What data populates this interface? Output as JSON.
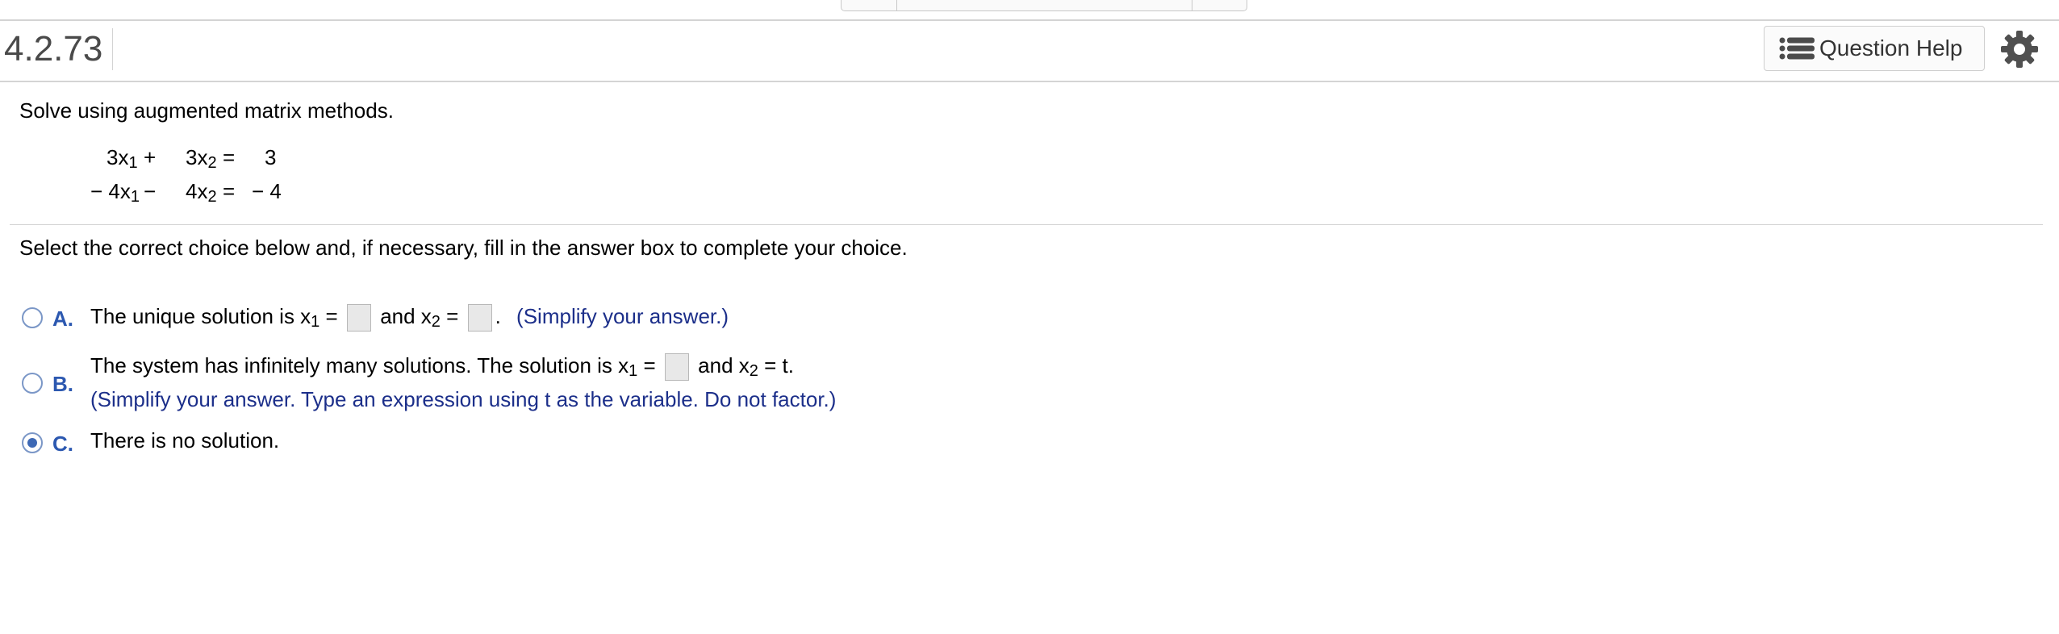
{
  "header": {
    "question_number": "4.2.73",
    "help_label": "Question Help",
    "help_icon": "list-icon",
    "settings_icon": "gear-icon"
  },
  "problem": {
    "instruction": "Solve using augmented matrix methods.",
    "equations": [
      {
        "t1_coef": "3x",
        "t1_sub": "1",
        "op": "+",
        "t2_coef": "3x",
        "t2_sub": "2",
        "eq": "=",
        "rhs": "3"
      },
      {
        "t1_coef": "− 4x",
        "t1_sub": "1",
        "op": "−",
        "t2_coef": "4x",
        "t2_sub": "2",
        "eq": "=",
        "rhs": "− 4"
      }
    ]
  },
  "prompt": "Select the correct choice below and, if necessary, fill in the answer box to complete your choice.",
  "choices": {
    "selected": "C",
    "a": {
      "letter": "A.",
      "t1": "The unique solution is x",
      "sub1": "1",
      "eq1": " =",
      "and": "and x",
      "sub2": "2",
      "eq2": " =",
      "period": ".",
      "hint": "(Simplify your answer.)",
      "value1": "",
      "value2": ""
    },
    "b": {
      "letter": "B.",
      "t1": "The system has infinitely many solutions. The solution is x",
      "sub1": "1",
      "eq1": " =",
      "and": "and x",
      "sub2": "2",
      "tail": " = t.",
      "hint": "(Simplify your answer. Type an expression using t as the variable. Do not factor.)",
      "value1": ""
    },
    "c": {
      "letter": "C.",
      "text": "There is no solution."
    }
  },
  "colors": {
    "choice_letter": "#2c58b0",
    "hint_text": "#1c2f8a",
    "radio_selected": "#3e69b5",
    "answer_box": "#e8e8e8"
  }
}
